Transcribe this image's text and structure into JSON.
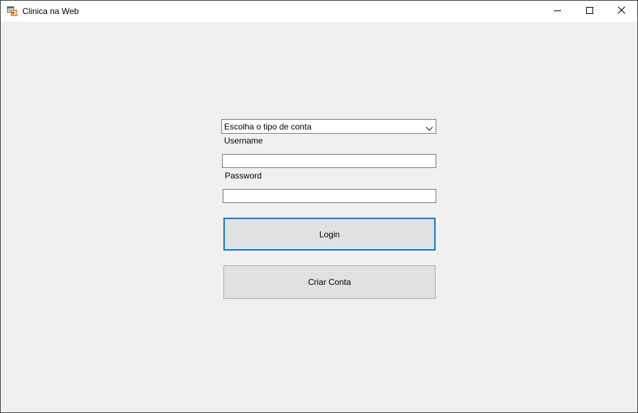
{
  "window": {
    "title": "Clinica na Web",
    "icon": "windows-form-icon",
    "controls": {
      "minimize": "minimize-icon",
      "maximize": "maximize-icon",
      "close": "close-icon"
    }
  },
  "form": {
    "account_type": {
      "selected": "Escolha o tipo de conta",
      "icon": "chevron-down-icon"
    },
    "username_label": "Username",
    "username_value": "",
    "password_label": "Password",
    "password_value": "",
    "login_label": "Login",
    "create_account_label": "Criar Conta"
  },
  "colors": {
    "focus_border": "#0078d7",
    "client_background": "#f0f0f0",
    "button_face": "#e1e1e1"
  }
}
